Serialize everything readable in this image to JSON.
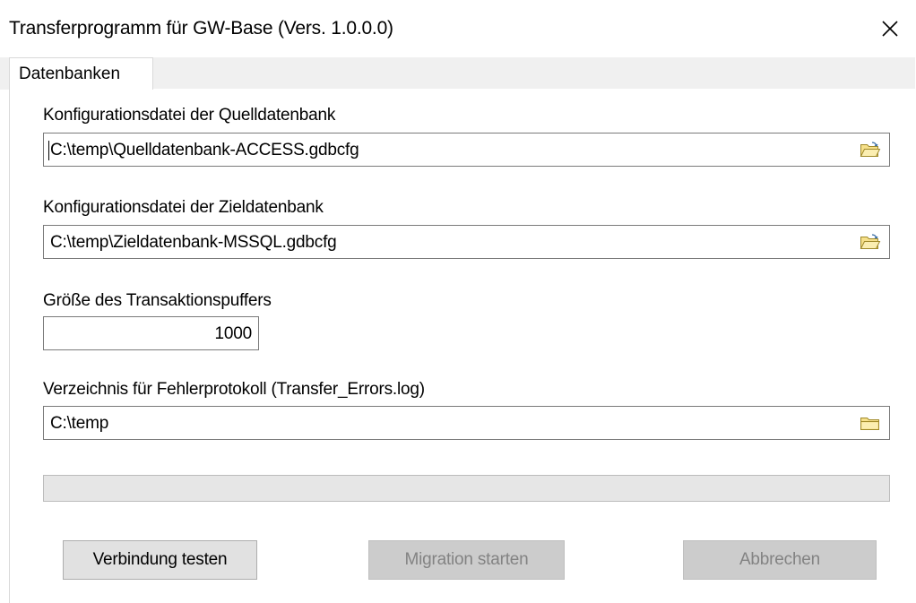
{
  "window": {
    "title": "Transferprogramm für GW-Base (Vers. 1.0.0.0)",
    "close_glyph": "✕"
  },
  "tabs": [
    {
      "label": "Datenbanken",
      "selected": true
    }
  ],
  "source_config": {
    "label": "Konfigurationsdatei der Quelldatenbank",
    "value": "C:\\temp\\Quelldatenbank-ACCESS.gdbcfg",
    "icon": "open-folder-icon"
  },
  "target_config": {
    "label": "Konfigurationsdatei der Zieldatenbank",
    "value": "C:\\temp\\Zieldatenbank-MSSQL.gdbcfg",
    "icon": "open-folder-icon"
  },
  "buffer_size": {
    "label": "Größe des Transaktionspuffers",
    "value": "1000"
  },
  "error_log_dir": {
    "label": "Verzeichnis für Fehlerprotokoll (Transfer_Errors.log)",
    "value": "C:\\temp",
    "icon": "folder-icon"
  },
  "progress": {
    "percent": 0
  },
  "buttons": {
    "test_connection": "Verbindung testen",
    "start_migration": "Migration starten",
    "cancel": "Abbrechen"
  },
  "colors": {
    "folder_fill": "#f6e08a",
    "folder_stroke": "#a08a2a",
    "disabled_button": "#cccccc",
    "progress_track": "#e6e6e6"
  }
}
